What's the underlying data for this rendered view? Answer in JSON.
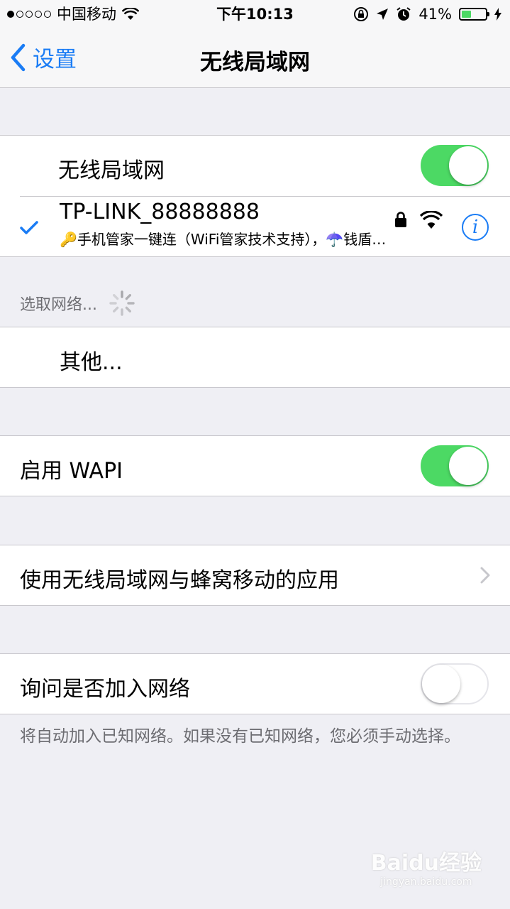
{
  "status_bar": {
    "carrier": "中国移动",
    "time": "下午10:13",
    "battery_percent": "41%",
    "battery_level": 0.41
  },
  "nav": {
    "back_label": "设置",
    "title": "无线局域网"
  },
  "wifi_toggle": {
    "label": "无线局域网",
    "on": true
  },
  "connected_network": {
    "name": "TP-LINK_88888888",
    "subtitle": "🔑手机管家一键连（WiFi管家技术支持），☂️钱盾…",
    "icons": [
      "checkmark-icon",
      "lock-icon",
      "wifi-icon",
      "info-icon"
    ]
  },
  "choose_network": {
    "header": "选取网络..."
  },
  "other_row": {
    "label": "其他..."
  },
  "wapi": {
    "label": "启用 WAPI",
    "on": true
  },
  "apps_row": {
    "label": "使用无线局域网与蜂窝移动的应用"
  },
  "ask_join": {
    "label": "询问是否加入网络",
    "on": false,
    "footer": "将自动加入已知网络。如果没有已知网络，您必须手动选择。"
  },
  "watermark": {
    "text": "Baidu经验",
    "sub": "jingyan.baidu.com"
  },
  "colors": {
    "accent": "#1a7cf5",
    "switch_on": "#4cd964",
    "background": "#efeff4"
  }
}
